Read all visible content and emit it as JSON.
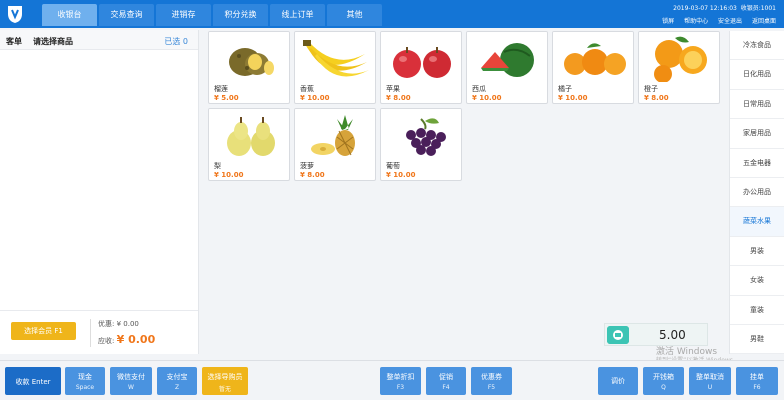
{
  "header": {
    "tabs": [
      {
        "label": "收银台",
        "active": true
      },
      {
        "label": "交易查询"
      },
      {
        "label": "进销存"
      },
      {
        "label": "积分兑换"
      },
      {
        "label": "线上订单"
      },
      {
        "label": "其他"
      }
    ],
    "datetime": "2019-03-07 12:16:03",
    "store": "收银员:1001",
    "links": [
      "锁屏",
      "帮助中心",
      "安全退出",
      "返回桌面"
    ]
  },
  "left": {
    "order_label": "客单",
    "prompt": "请选择商品",
    "selected": "已选 0",
    "member_button": "选择会员 F1",
    "discount_label": "优惠: ¥ 0.00",
    "due_label": "应收:",
    "due_value": "¥ 0.00"
  },
  "products": [
    {
      "name": "榴莲",
      "price": "¥ 5.00",
      "icon": "durian"
    },
    {
      "name": "香蕉",
      "price": "¥ 10.00",
      "icon": "banana"
    },
    {
      "name": "苹果",
      "price": "¥ 8.00",
      "icon": "apple"
    },
    {
      "name": "西瓜",
      "price": "¥ 10.00",
      "icon": "watermelon"
    },
    {
      "name": "橘子",
      "price": "¥ 10.00",
      "icon": "tangerine"
    },
    {
      "name": "橙子",
      "price": "¥ 8.00",
      "icon": "orange"
    },
    {
      "name": "梨",
      "price": "¥ 10.00",
      "icon": "pear"
    },
    {
      "name": "菠萝",
      "price": "¥ 8.00",
      "icon": "pineapple"
    },
    {
      "name": "葡萄",
      "price": "¥ 10.00",
      "icon": "grape"
    }
  ],
  "categories": [
    {
      "label": "冷冻食品"
    },
    {
      "label": "日化用品"
    },
    {
      "label": "日常用品"
    },
    {
      "label": "家居用品"
    },
    {
      "label": "五金电器"
    },
    {
      "label": "办公用品"
    },
    {
      "label": "蔬菜水果",
      "active": true
    },
    {
      "label": "男装"
    },
    {
      "label": "女装"
    },
    {
      "label": "童装"
    },
    {
      "label": "男鞋"
    }
  ],
  "amount": "5.00",
  "watermark": {
    "line1": "激活 Windows",
    "line2": "转到“设置”以激活 Windows。"
  },
  "footer": {
    "checkout": "收款 Enter",
    "cash": {
      "l1": "现金",
      "l2": "Space"
    },
    "wechat": {
      "l1": "微信支付",
      "l2": "W"
    },
    "alipay": {
      "l1": "支付宝",
      "l2": "Z"
    },
    "guide": {
      "l1": "选择导购员",
      "l2": "暂无"
    },
    "order_discount": {
      "l1": "整单折扣",
      "l2": "F3"
    },
    "promo": {
      "l1": "促销",
      "l2": "F4"
    },
    "coupon": {
      "l1": "优惠券",
      "l2": "F5"
    },
    "price_adjust": {
      "l1": "调价"
    },
    "open_drawer": {
      "l1": "开钱箱",
      "l2": "Q"
    },
    "cancel_order": {
      "l1": "整单取消",
      "l2": "U"
    },
    "hold": {
      "l1": "挂单",
      "l2": "F6"
    }
  }
}
